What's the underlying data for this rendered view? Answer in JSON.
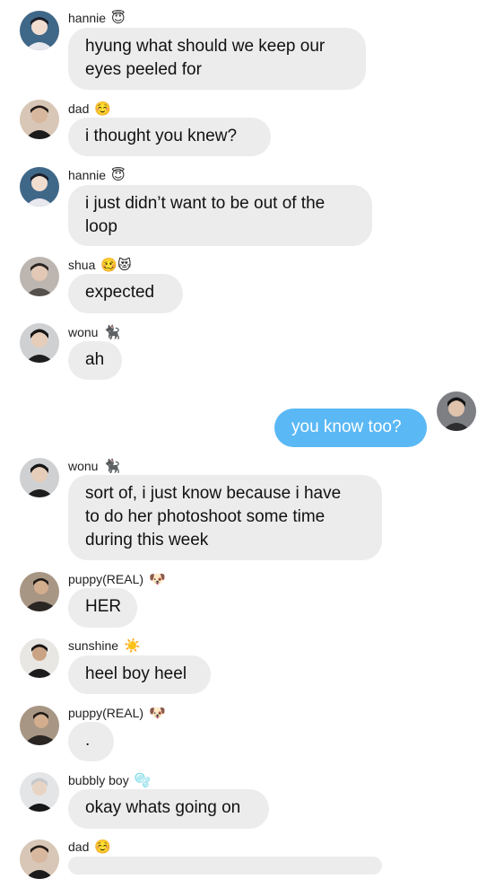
{
  "messages": [
    {
      "sender": "hannie",
      "emoji": "😇",
      "text": [
        "hyung what should we keep our",
        "eyes peeled for"
      ]
    },
    {
      "sender": "dad",
      "emoji": "☺️",
      "text": [
        "i thought you knew?"
      ]
    },
    {
      "sender": "hannie",
      "emoji": "😇",
      "text": [
        "i just didn’t want to be out of the",
        "loop"
      ]
    },
    {
      "sender": "shua",
      "emoji": "🥴😻",
      "text": [
        "expected"
      ]
    },
    {
      "sender": "wonu",
      "emoji": "🐈‍⬛",
      "text": [
        "ah"
      ]
    },
    {
      "sender": "me",
      "emoji": "",
      "text": [
        "you know too?"
      ]
    },
    {
      "sender": "wonu",
      "emoji": "🐈‍⬛",
      "text": [
        "sort of, i just know because i have",
        "to do her photoshoot some time",
        "during this week"
      ]
    },
    {
      "sender": "puppy(REAL)",
      "emoji": "🐶",
      "text": [
        "HER"
      ]
    },
    {
      "sender": "sunshine",
      "emoji": "☀️",
      "text": [
        "heel boy heel"
      ]
    },
    {
      "sender": "puppy(REAL)",
      "emoji": "🐶",
      "text": [
        "."
      ]
    },
    {
      "sender": "bubbly boy",
      "emoji": "🫧",
      "text": [
        "okay whats going on"
      ]
    },
    {
      "sender": "dad",
      "emoji": "☺️",
      "text": []
    }
  ],
  "colors": {
    "incoming_bubble": "#ececec",
    "outgoing_bubble": "#5ab8f5"
  }
}
